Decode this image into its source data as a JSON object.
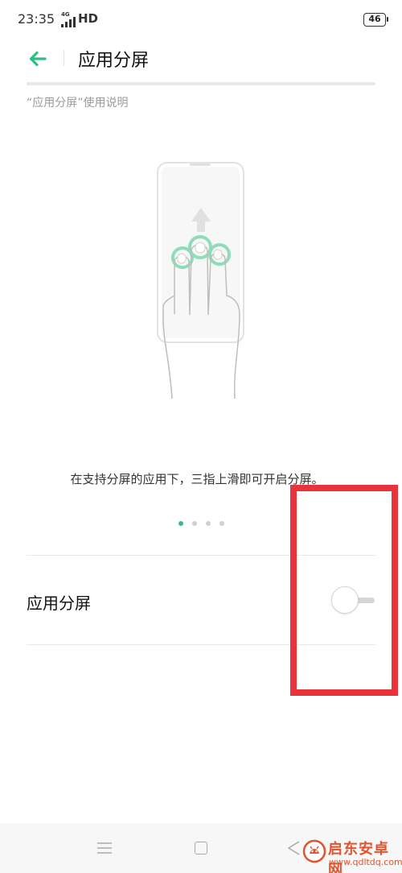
{
  "status_bar": {
    "time": "23:35",
    "network": "4G",
    "hd": "HD",
    "battery": "46"
  },
  "header": {
    "title": "应用分屏",
    "back_icon": "arrow-left-icon",
    "accent_color": "#2fbf83"
  },
  "intro": {
    "section_label": "“应用分屏”使用说明",
    "illustration_icon": "three-finger-swipe-up-icon",
    "caption": "在支持分屏的应用下，三指上滑即可开启分屏。",
    "pager": {
      "total": 4,
      "active_index": 0
    }
  },
  "setting": {
    "label": "应用分屏",
    "toggle_on": false
  },
  "annotation": {
    "color": "#e8333b"
  },
  "nav_bar": {
    "menu_icon": "menu-icon",
    "home_icon": "home-icon",
    "back_icon": "back-triangle-icon"
  },
  "watermark": {
    "title": "启东安卓网",
    "url": "www.qdltdq.com"
  }
}
